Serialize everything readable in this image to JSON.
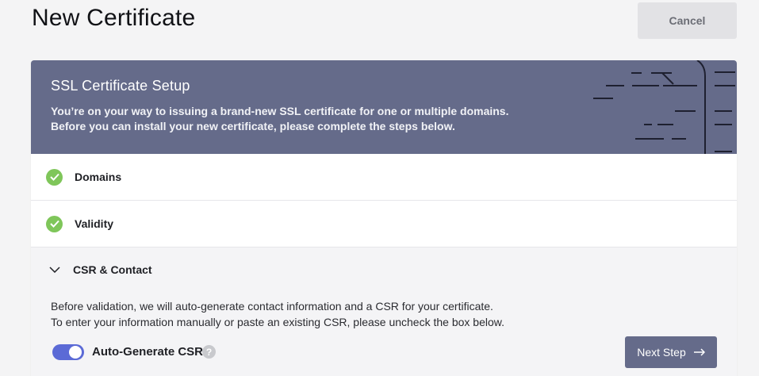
{
  "header": {
    "title": "New Certificate",
    "cancel_label": "Cancel"
  },
  "banner": {
    "title": "SSL Certificate Setup",
    "line1": "You’re on your way to issuing a brand-new SSL certificate for one or multiple domains.",
    "line2": "Before you can install your new certificate, please complete the steps below.",
    "background": "#656b8a"
  },
  "steps": [
    {
      "label": "Domains",
      "status": "complete",
      "icon": "check-circle-icon"
    },
    {
      "label": "Validity",
      "status": "complete",
      "icon": "check-circle-icon"
    },
    {
      "label": "CSR & Contact",
      "status": "open",
      "icon": "chevron-down-icon"
    }
  ],
  "csr": {
    "desc1": "Before validation, we will auto-generate contact information and a CSR for your certificate.",
    "desc2": "To enter your information manually or paste an existing CSR, please uncheck the box below.",
    "toggle_label": "Auto-Generate CSR",
    "toggle_on": true,
    "help_icon": "?",
    "next_label": "Next Step"
  },
  "colors": {
    "accent": "#5b6ad6",
    "success": "#7fc65a",
    "primary_button": "#656b8a"
  }
}
